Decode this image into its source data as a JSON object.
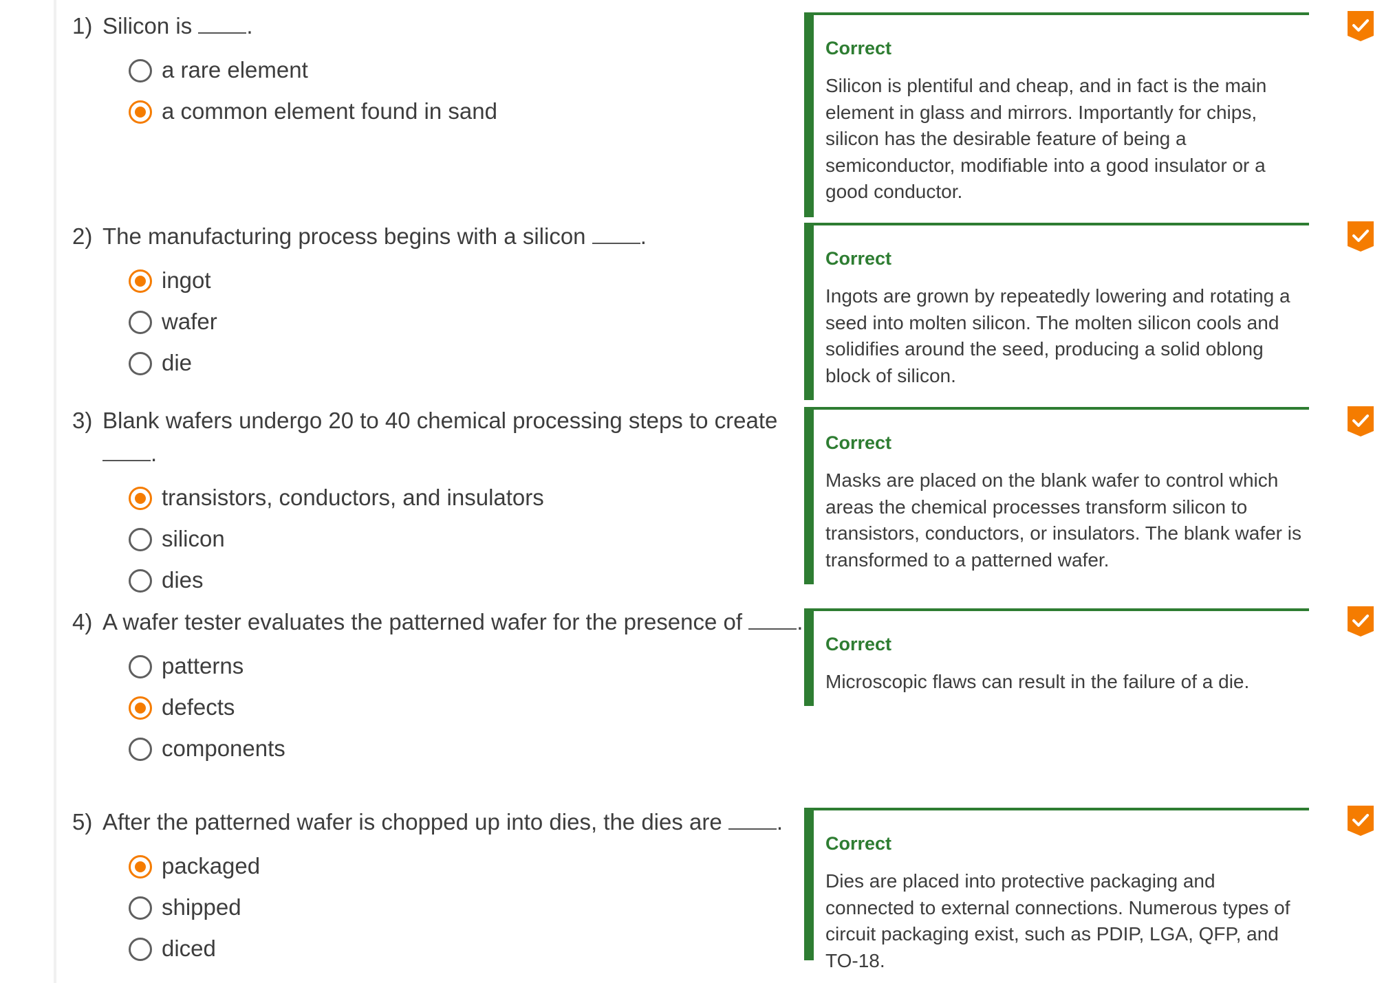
{
  "questions": [
    {
      "number": "1)",
      "text": "Silicon is ",
      "suffix": ".",
      "options": [
        {
          "label": "a rare element",
          "selected": false
        },
        {
          "label": "a common element found in sand",
          "selected": true
        }
      ],
      "feedback": {
        "title": "Correct",
        "text": "Silicon is plentiful and cheap, and in fact is the main element in glass and mirrors. Importantly for chips, silicon has the desirable feature of being a semiconductor, modifiable into a good insulator or a good conductor."
      }
    },
    {
      "number": "2)",
      "text": "The manufacturing process begins with a silicon ",
      "suffix": ".",
      "options": [
        {
          "label": "ingot",
          "selected": true
        },
        {
          "label": "wafer",
          "selected": false
        },
        {
          "label": "die",
          "selected": false
        }
      ],
      "feedback": {
        "title": "Correct",
        "text": "Ingots are grown by repeatedly lowering and rotating a seed into molten silicon. The molten silicon cools and solidifies around the seed, producing a solid oblong block of silicon."
      }
    },
    {
      "number": "3)",
      "text": "Blank wafers undergo 20 to 40 chemical processing steps to create ",
      "suffix": ".",
      "options": [
        {
          "label": "transistors, conductors, and insulators",
          "selected": true
        },
        {
          "label": "silicon",
          "selected": false
        },
        {
          "label": "dies",
          "selected": false
        }
      ],
      "feedback": {
        "title": "Correct",
        "text": "Masks are placed on the blank wafer to control which areas the chemical processes transform silicon to transistors, conductors, or insulators. The blank wafer is transformed to a patterned wafer."
      }
    },
    {
      "number": "4)",
      "text": "A wafer tester evaluates the patterned wafer for the presence of ",
      "suffix": ".",
      "options": [
        {
          "label": "patterns",
          "selected": false
        },
        {
          "label": "defects",
          "selected": true
        },
        {
          "label": "components",
          "selected": false
        }
      ],
      "feedback": {
        "title": "Correct",
        "text": "Microscopic flaws can result in the failure of a die."
      }
    },
    {
      "number": "5)",
      "text": "After the patterned wafer is chopped up into dies, the dies are ",
      "suffix": ".",
      "options": [
        {
          "label": "packaged",
          "selected": true
        },
        {
          "label": "shipped",
          "selected": false
        },
        {
          "label": "diced",
          "selected": false
        }
      ],
      "feedback": {
        "title": "Correct",
        "text": "Dies are placed into protective packaging and connected to external connections. Numerous types of circuit packaging exist, such as PDIP, LGA, QFP, and TO-18."
      }
    }
  ],
  "colors": {
    "accent_orange": "#f57c00",
    "correct_green": "#2e7d32",
    "text": "#3d3d3d"
  },
  "icons": {
    "completion": "checkmark-badge-icon"
  }
}
